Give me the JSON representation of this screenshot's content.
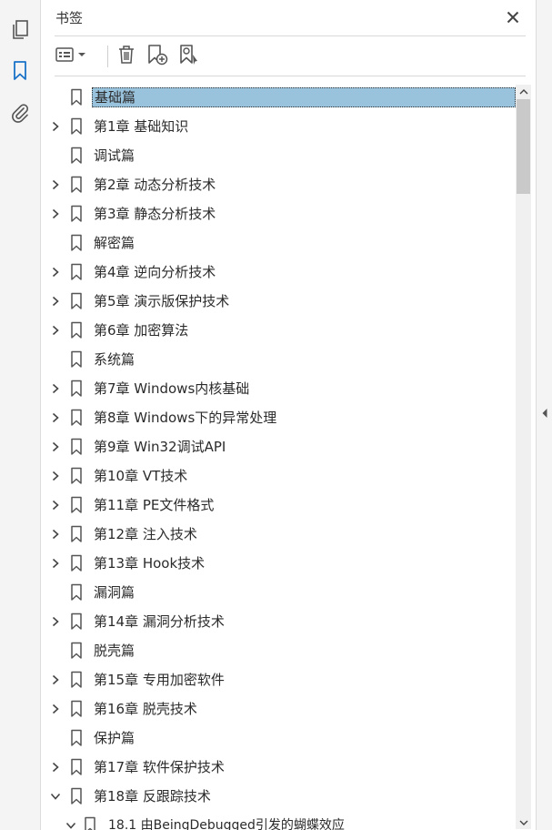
{
  "panel": {
    "title": "书签"
  },
  "icons": {
    "rail": [
      "pages-icon",
      "bookmark-icon",
      "attachment-icon"
    ],
    "toolbar": [
      "options-menu-icon",
      "delete-bookmark-icon",
      "new-bookmark-icon",
      "find-bookmark-icon"
    ]
  },
  "colors": {
    "accent": "#1a73c8",
    "selection": "#99c2dd",
    "icon": "#555555"
  },
  "bookmarks": [
    {
      "label": "基础篇",
      "expandable": false,
      "selected": true
    },
    {
      "label": "第1章 基础知识",
      "expandable": true
    },
    {
      "label": "调试篇",
      "expandable": false
    },
    {
      "label": "第2章 动态分析技术",
      "expandable": true
    },
    {
      "label": "第3章 静态分析技术",
      "expandable": true
    },
    {
      "label": "解密篇",
      "expandable": false
    },
    {
      "label": "第4章 逆向分析技术",
      "expandable": true
    },
    {
      "label": "第5章 演示版保护技术",
      "expandable": true
    },
    {
      "label": "第6章 加密算法",
      "expandable": true
    },
    {
      "label": "系统篇",
      "expandable": false
    },
    {
      "label": "第7章 Windows内核基础",
      "expandable": true
    },
    {
      "label": "第8章 Windows下的异常处理",
      "expandable": true
    },
    {
      "label": "第9章 Win32调试API",
      "expandable": true
    },
    {
      "label": "第10章 VT技术",
      "expandable": true
    },
    {
      "label": "第11章 PE文件格式",
      "expandable": true
    },
    {
      "label": "第12章 注入技术",
      "expandable": true
    },
    {
      "label": "第13章 Hook技术",
      "expandable": true
    },
    {
      "label": "漏洞篇",
      "expandable": false
    },
    {
      "label": "第14章 漏洞分析技术",
      "expandable": true
    },
    {
      "label": "脱壳篇",
      "expandable": false
    },
    {
      "label": "第15章 专用加密软件",
      "expandable": true
    },
    {
      "label": "第16章 脱壳技术",
      "expandable": true
    },
    {
      "label": "保护篇",
      "expandable": false
    },
    {
      "label": "第17章 软件保护技术",
      "expandable": true
    },
    {
      "label": "第18章 反跟踪技术",
      "expandable": true,
      "expanded": true
    },
    {
      "label": "18.1 由BeingDebugged引发的蝴蝶效应",
      "expandable": true,
      "expanded": true,
      "child": true
    }
  ]
}
